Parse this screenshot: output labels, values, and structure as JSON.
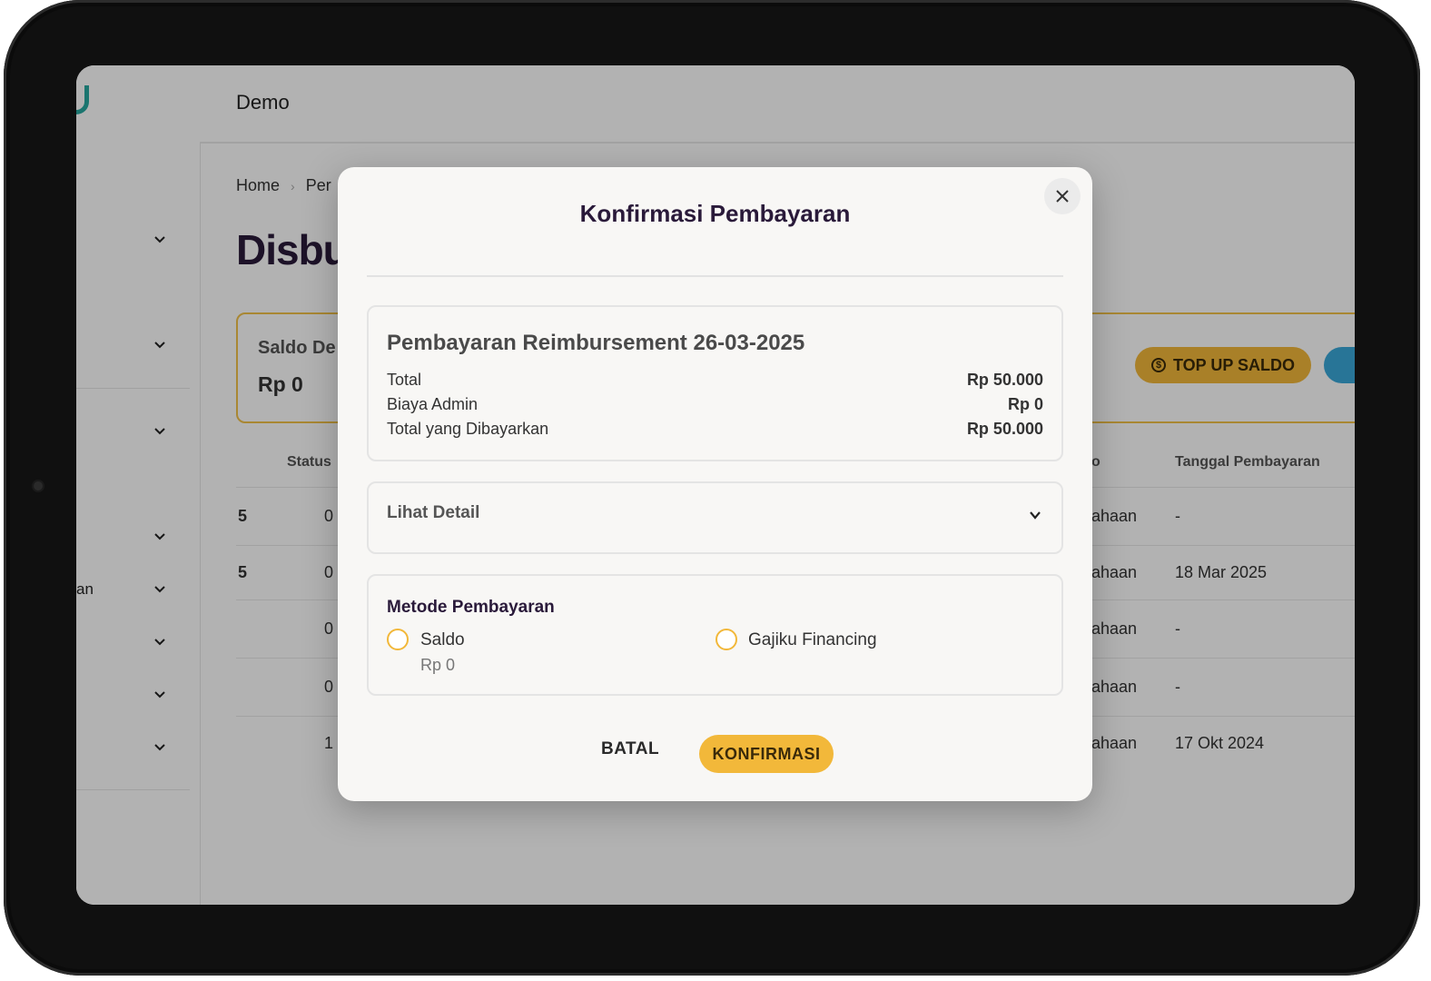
{
  "app": {
    "org_name": "Demo",
    "breadcrumb": {
      "home": "Home",
      "current": "Per"
    },
    "page_title": "Disbu",
    "saldo_card": {
      "label": "Saldo De",
      "value": "Rp 0"
    },
    "topup_label": "TOP UP SALDO",
    "sidebar": {
      "partial_text": "an"
    },
    "table": {
      "headers": {
        "status": "Status",
        "col_b": "o",
        "tanggal": "Tanggal Pembayaran"
      },
      "rows": [
        {
          "c1": "5",
          "c2": "0",
          "c3": "ahaan",
          "date": "-"
        },
        {
          "c1": "5",
          "c2": "0",
          "c3": "ahaan",
          "date": "18 Mar 2025"
        },
        {
          "c1": "",
          "c2": "0",
          "c3": "ahaan",
          "date": "-"
        },
        {
          "c1": "",
          "c2": "0",
          "c3": "ahaan",
          "date": "-"
        },
        {
          "c1": "",
          "c2": "1",
          "c3": "ahaan",
          "date": "17 Okt 2024"
        }
      ]
    }
  },
  "modal": {
    "title": "Konfirmasi Pembayaran",
    "close_icon": "×",
    "summary": {
      "title": "Pembayaran Reimbursement 26-03-2025",
      "total_label": "Total",
      "total_value": "Rp 50.000",
      "admin_label": "Biaya Admin",
      "admin_value": "Rp 0",
      "paid_label": "Total yang Dibayarkan",
      "paid_value": "Rp 50.000"
    },
    "detail_label": "Lihat Detail",
    "method": {
      "label": "Metode Pembayaran",
      "option_saldo": "Saldo",
      "option_saldo_sub": "Rp 0",
      "option_financing": "Gajiku Financing"
    },
    "cancel_label": "BATAL",
    "confirm_label": "KONFIRMASI"
  },
  "colors": {
    "accent": "#f2b83a",
    "brand_teal": "#27a8a0",
    "title": "#2a1a3a"
  }
}
